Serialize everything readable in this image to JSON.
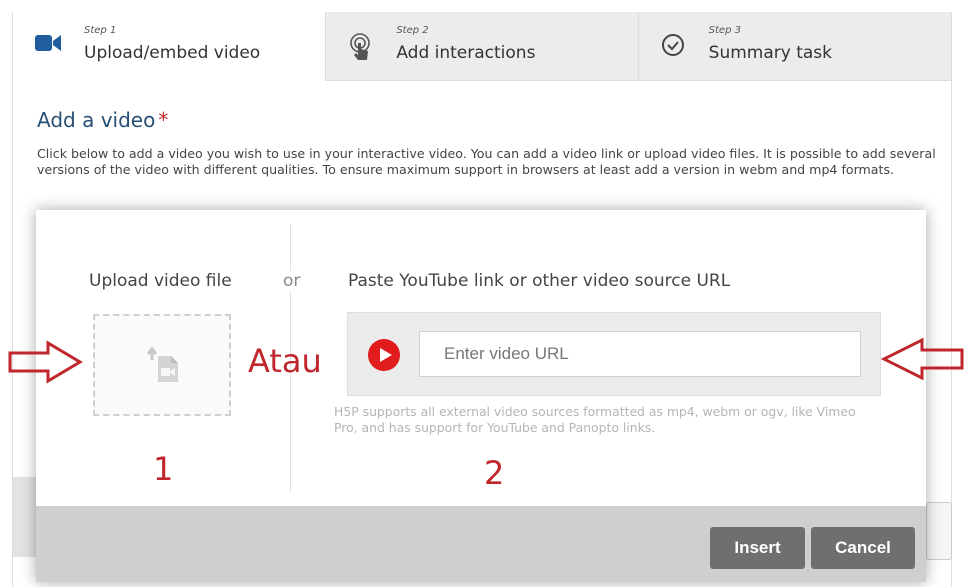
{
  "tabs": [
    {
      "step": "Step 1",
      "label": "Upload/embed video",
      "icon": "video-camera-icon",
      "active": true
    },
    {
      "step": "Step 2",
      "label": "Add interactions",
      "icon": "touch-pointer-icon",
      "active": false
    },
    {
      "step": "Step 3",
      "label": "Summary task",
      "icon": "check-circle-icon",
      "active": false
    }
  ],
  "section": {
    "title": "Add a video",
    "required_mark": "*",
    "description": "Click below to add a video you wish to use in your interactive video. You can add a video link or upload video files. It is possible to add several versions of the video with different qualities. To ensure maximum support in browsers at least add a version in webm and mp4 formats."
  },
  "dialog": {
    "upload_label": "Upload video file",
    "or_label": "or",
    "paste_label": "Paste YouTube link or other video source URL",
    "url_placeholder": "Enter video URL",
    "url_value": "",
    "help_text": "H5P supports all external video sources formatted as mp4, webm or ogv, like Vimeo Pro, and has support for YouTube and Panopto links.",
    "insert_label": "Insert",
    "cancel_label": "Cancel"
  },
  "annotations": {
    "atau": "Atau",
    "num1": "1",
    "num2": "2"
  },
  "colors": {
    "accent_blue": "#274f73",
    "video_icon": "#1f5d9e",
    "required_red": "#c0272d",
    "youtube_red": "#e01c1c",
    "annotation_red": "#c0272d",
    "button_gray": "#6f6f6f"
  }
}
